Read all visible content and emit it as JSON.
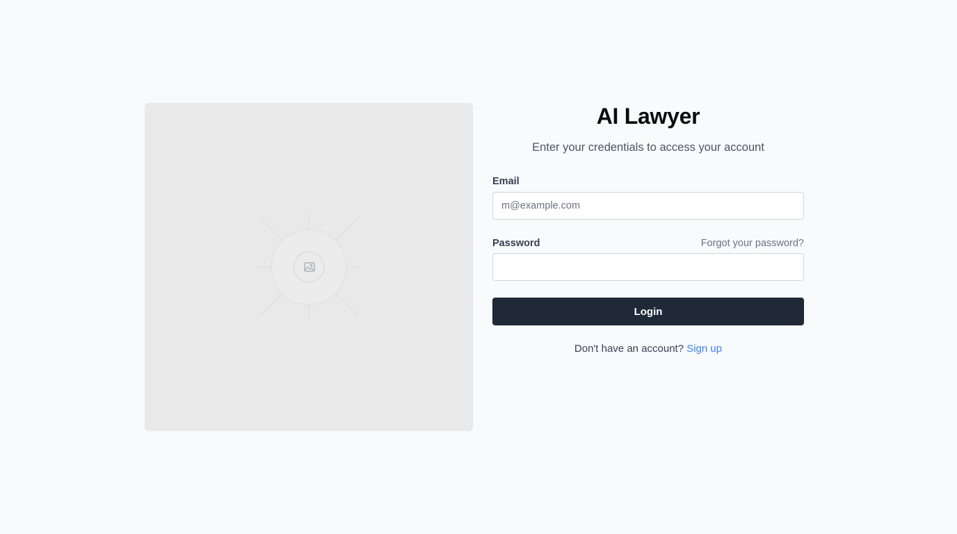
{
  "image_panel": {
    "icon": "image-placeholder-icon"
  },
  "login": {
    "title": "AI Lawyer",
    "subtitle": "Enter your credentials to access your account",
    "email_label": "Email",
    "email_placeholder": "m@example.com",
    "email_value": "",
    "password_label": "Password",
    "password_value": "",
    "forgot_link": "Forgot your password?",
    "login_button": "Login",
    "signup_prompt": "Don't have an account?",
    "signup_link": "Sign up"
  },
  "colors": {
    "background": "#f8fafc",
    "button": "#1f2937",
    "link_accent": "#3b82f6"
  }
}
